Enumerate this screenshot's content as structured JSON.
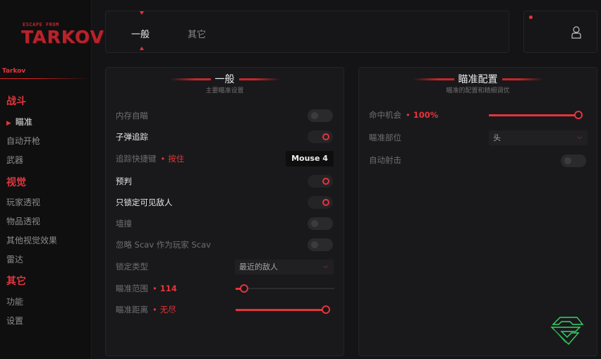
{
  "sidebar": {
    "logo": {
      "small": "ESCAPE FROM",
      "big": "TARKOV"
    },
    "brand": "Tarkov",
    "sections": [
      {
        "label": "战斗",
        "items": [
          "瞄准",
          "自动开枪",
          "武器"
        ]
      },
      {
        "label": "视觉",
        "items": [
          "玩家透视",
          "物品透视",
          "其他视觉效果",
          "雷达"
        ]
      },
      {
        "label": "其它",
        "items": [
          "功能",
          "设置"
        ]
      }
    ],
    "active_item": "瞄准"
  },
  "tabs": [
    {
      "label": "一般",
      "active": true
    },
    {
      "label": "其它",
      "active": false
    }
  ],
  "user": {
    "icon": "user-icon"
  },
  "general_panel": {
    "title": "一般",
    "subtitle": "主要瞄准设置",
    "rows": {
      "memory_aim": {
        "label": "内存自瞄",
        "enabled": false
      },
      "bullet_track": {
        "label": "子弹追踪",
        "enabled": true
      },
      "track_hotkey": {
        "label": "追踪快捷键",
        "mode": "按住",
        "key": "Mouse 4"
      },
      "prediction": {
        "label": "预判",
        "enabled": true
      },
      "visible_only": {
        "label": "只锁定可见敌人",
        "enabled": true
      },
      "wallbang": {
        "label": "墙撞",
        "enabled": false
      },
      "ignore_scav": {
        "label": "忽略 Scav 作为玩家 Scav",
        "enabled": false
      },
      "lock_type": {
        "label": "锁定类型",
        "value": "最近的敌人"
      },
      "aim_fov": {
        "label": "瞄准范围",
        "value": 114,
        "display": "114",
        "fraction": 0.05
      },
      "aim_distance": {
        "label": "瞄准距离",
        "display": "无尽",
        "fraction": 1.0
      }
    }
  },
  "aim_config_panel": {
    "title": "瞄准配置",
    "subtitle": "瞄准的配置和精细调优",
    "rows": {
      "hit_chance": {
        "label": "命中机会",
        "display": "100%",
        "value": 100,
        "fraction": 1.0
      },
      "aim_bone": {
        "label": "瞄准部位",
        "value": "头"
      },
      "auto_shoot": {
        "label": "自动射击",
        "enabled": false
      }
    }
  },
  "colors": {
    "accent": "#e2353b",
    "background": "#141416",
    "panel": "#19191b",
    "toggle_off": "#2a2a2d"
  }
}
